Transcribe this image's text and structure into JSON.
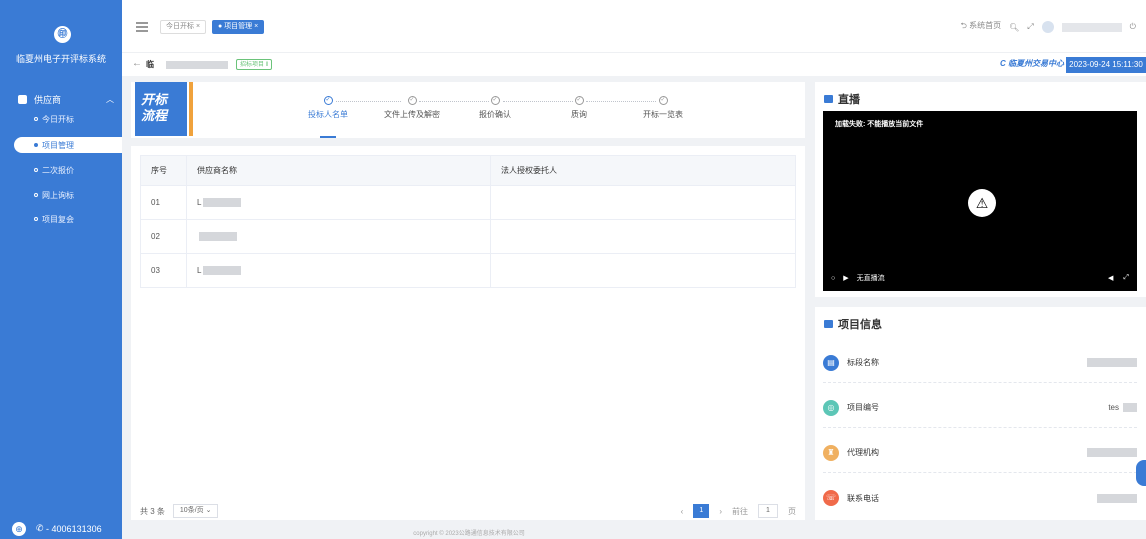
{
  "sidebar": {
    "logo_glyph": "㊞",
    "app_title": "临夏州电子开评标系统",
    "group_label": "供应商",
    "items": [
      {
        "label": "今日开标"
      },
      {
        "label": "项目管理"
      },
      {
        "label": "二次报价"
      },
      {
        "label": "网上询标"
      },
      {
        "label": "项目复会"
      }
    ],
    "footer_phone": "- 4006131306"
  },
  "topbar": {
    "tabs": [
      {
        "label": "今日开标 ×"
      },
      {
        "label": "● 项目管理 ×"
      }
    ],
    "home_link": "⮌ 系统首页"
  },
  "subheader": {
    "back": "←",
    "project_prefix": "临",
    "project_tag": "招标项目 ‖",
    "brand": "C 临夏州交易中心",
    "datetime": "2023-09-24  15:11:30"
  },
  "flow": {
    "badge_line1": "开标",
    "badge_line2": "流程",
    "steps": [
      {
        "label": "投标人名单"
      },
      {
        "label": "文件上传及解密"
      },
      {
        "label": "报价确认"
      },
      {
        "label": "质询"
      },
      {
        "label": "开标一览表"
      }
    ]
  },
  "table": {
    "headers": [
      "序号",
      "供应商名称",
      "法人授权委托人"
    ],
    "rows": [
      {
        "index": "01",
        "name_prefix": "L"
      },
      {
        "index": "02",
        "name_prefix": ""
      },
      {
        "index": "03",
        "name_prefix": "L"
      }
    ]
  },
  "pager": {
    "total": "共 3 条",
    "page_size": "10条/页",
    "page": "1",
    "goto_label": "前往",
    "goto_value": "1",
    "page_unit": "页"
  },
  "live": {
    "title": "直播",
    "error": "加载失败: 不能播放当前文件",
    "status": "无直播流"
  },
  "info": {
    "title": "项目信息",
    "rows": [
      {
        "label": "标段名称",
        "value": "",
        "color": "#3a7bd5",
        "glyph": "▤"
      },
      {
        "label": "项目编号",
        "value": "tes",
        "color": "#5cc6b6",
        "glyph": "◎"
      },
      {
        "label": "代理机构",
        "value": "",
        "color": "#f0b060",
        "glyph": "♜"
      },
      {
        "label": "联系电话",
        "value": "",
        "color": "#f06a4a",
        "glyph": "☏"
      }
    ]
  },
  "copyright": "copyright © 2023公路通信息技术有限公司"
}
